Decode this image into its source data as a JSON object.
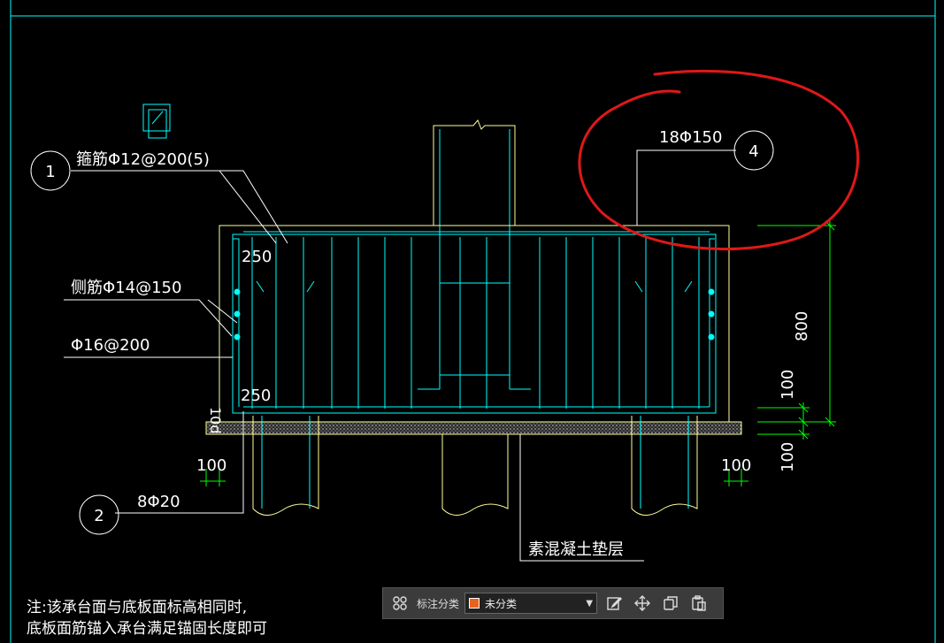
{
  "drawing": {
    "callout_1": {
      "marker": "1",
      "text": "箍筋Φ12@200(5)"
    },
    "callout_2": {
      "marker": "2",
      "text": "8Φ20"
    },
    "callout_4": {
      "marker": "4",
      "text": "18Φ150"
    },
    "side_bar": "侧筋Φ14@150",
    "bottom_bar": "Φ16@200",
    "dim_250_top": "250",
    "dim_250_bottom": "250",
    "dim_800": "800",
    "dim_100_right_upper": "100",
    "dim_100_right_lower": "100",
    "dim_100_left": "100",
    "dim_100_right": "100",
    "dim_10d": "10d",
    "cushion_label": "素混凝土垫层",
    "note_line1": "注:该承台面与底板面标高相同时,",
    "note_line2": "底板面筋锚入承台满足锚固长度即可"
  },
  "colors": {
    "line": "#ffffff",
    "rebar": "#00ffff",
    "concrete": "#ffff99",
    "dimension": "#00ff00",
    "markup": "#e01818",
    "swatch": "#e8641e"
  },
  "toolbar": {
    "label": "标注分类",
    "category_value": "未分类",
    "icons": [
      "grid-icon",
      "edit-icon",
      "move-icon",
      "copy-icon",
      "paste-icon"
    ]
  }
}
